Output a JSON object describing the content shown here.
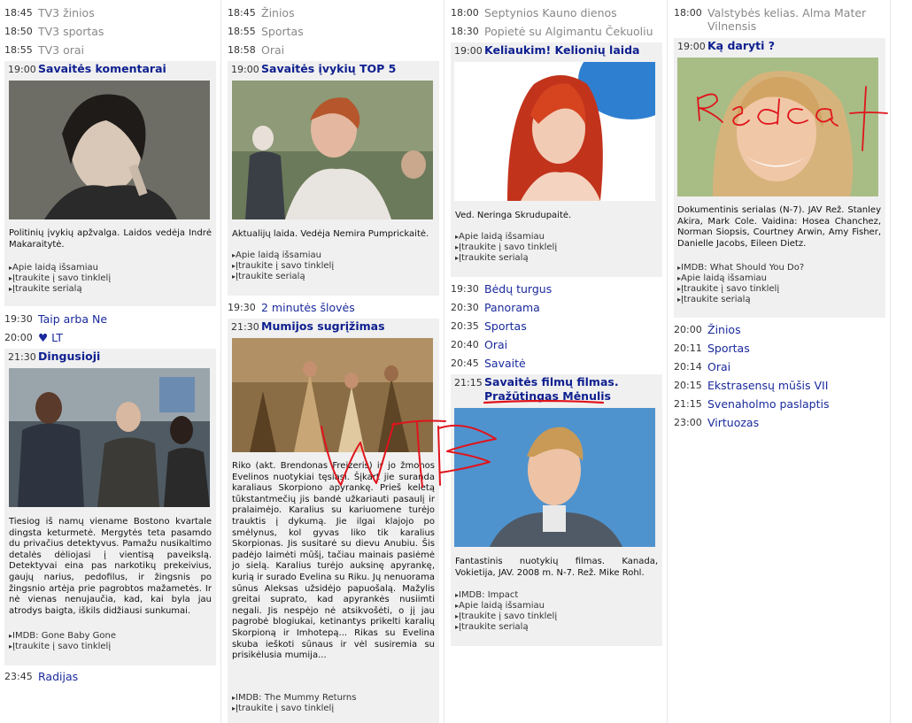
{
  "col1": {
    "pre": [
      {
        "time": "18:45",
        "title": "TV3 žinios"
      },
      {
        "time": "18:50",
        "title": "TV3 sportas"
      },
      {
        "time": "18:55",
        "title": "TV3 orai"
      }
    ],
    "feat1": {
      "time": "19:00",
      "title": "Savaitės komentarai",
      "desc": "Politinių įvykių apžvalga. Laidos vedėja Indrė Makaraitytė.",
      "links": [
        "Apie laidą išsamiau",
        "Įtraukite į savo tinklelį",
        "Įtraukite serialą"
      ]
    },
    "mid": [
      {
        "time": "19:30",
        "title": "Taip arba Ne"
      },
      {
        "time": "20:00",
        "title": "♥ LT"
      }
    ],
    "feat2": {
      "time": "21:30",
      "title": "Dingusioji",
      "desc": "Tiesiog iš namų viename Bostono kvartale dingsta keturmetė. Mergytės teta pasamdo du privačius detektyvus. Pamažu nusikaltimo detalės dėliojasi į vientisą paveikslą. Detektyvai eina pas narkotikų prekeivius, gaujų narius, pedofilus, ir žingsnis po žingsnio artėja prie pagrobtos mažametės. Ir nė vienas nenujaučia, kad, kai byla jau atrodys baigta, iškils didžiausi sunkumai.",
      "links": [
        "IMDB: Gone Baby Gone",
        "Įtraukite į savo tinklelį"
      ]
    },
    "post": [
      {
        "time": "23:45",
        "title": "Radijas"
      }
    ]
  },
  "col2": {
    "pre": [
      {
        "time": "18:45",
        "title": "Žinios"
      },
      {
        "time": "18:55",
        "title": "Sportas"
      },
      {
        "time": "18:58",
        "title": "Orai"
      }
    ],
    "feat1": {
      "time": "19:00",
      "title": "Savaitės įvykių TOP 5",
      "desc": "Aktualijų laida. Vedėja Nemira Pumprickaitė.",
      "links": [
        "Apie laidą išsamiau",
        "Įtraukite į savo tinklelį",
        "Įtraukite serialą"
      ]
    },
    "mid": [
      {
        "time": "19:30",
        "title": "2 minutės šlovės"
      }
    ],
    "feat2": {
      "time": "21:30",
      "title": "Mumijos sugrįžimas",
      "desc": "Riko (akt. Brendonas Freizeris) ir jo žmonos Evelinos nuotykiai tęsiasi. Šįkart jie suranda karaliaus Skorpiono apyrankę. Prieš keletą tūkstantmečių jis bandė užkariauti pasaulį ir pralaimėjo. Karalius su kariuomene turėjo trauktis į dykumą. Jie ilgai klajojo po smėlynus, kol gyvas liko tik karalius Skorpionas. Jis susitarė su dievu Anubiu. Šis padėjo laimėti mūšį, tačiau mainais pasiėmė jo sielą. Karalius turėjo auksinę apyrankę, kurią ir surado Evelina su Riku. Jų nenuorama sūnus Aleksas užsidėjo papuošalą. Mažylis greitai suprato, kad apyrankės nusiimti negali. Jis nespėjo nė atsikvošėti, o jį jau pagrobė blogiukai, ketinantys prikelti karalių Skorpioną ir Imhotepą... Rikas su Evelina skuba ieškoti sūnaus ir vėl susiremia su prisikėlusia mumija...",
      "links": [
        "IMDB: The Mummy Returns",
        "Įtraukite į savo tinklelį"
      ]
    }
  },
  "col3": {
    "pre": [
      {
        "time": "18:00",
        "title": "Septynios Kauno dienos"
      },
      {
        "time": "18:30",
        "title": "Popietė su Algimantu Čekuoliu"
      }
    ],
    "feat1": {
      "time": "19:00",
      "title": "Keliaukim! Kelionių laida",
      "desc": "Ved. Neringa Skrudupaitė.",
      "links": [
        "Apie laidą išsamiau",
        "Įtraukite į savo tinklelį",
        "Įtraukite serialą"
      ]
    },
    "mid": [
      {
        "time": "19:30",
        "title": "Bėdų turgus"
      },
      {
        "time": "20:30",
        "title": "Panorama"
      },
      {
        "time": "20:35",
        "title": "Sportas"
      },
      {
        "time": "20:40",
        "title": "Orai"
      },
      {
        "time": "20:45",
        "title": "Savaitė"
      }
    ],
    "feat2": {
      "time": "21:15",
      "title1": "Savaitės filmų filmas.",
      "title2": "Pražūtingas Mėnulis",
      "desc": "Fantastinis nuotykių filmas. Kanada, Vokietija, JAV. 2008 m. N-7. Rež. Mike Rohl.",
      "links": [
        "IMDB: Impact",
        "Apie laidą išsamiau",
        "Įtraukite į savo tinklelį",
        "Įtraukite serialą"
      ]
    }
  },
  "col4": {
    "pre": [
      {
        "time": "18:00",
        "title": "Valstybės kelias. Alma Mater Vilnensis"
      }
    ],
    "feat1": {
      "time": "19:00",
      "title": "Ką daryti ?",
      "desc": "Dokumentinis serialas (N-7). JAV Rež. Stanley Akira, Mark Cole. Vaidina: Hosea Chanchez, Norman Siopsis, Courtney Arwin, Amy Fisher, Danielle Jacobs, Eileen Dietz.",
      "links": [
        "IMDB: What Should You Do?",
        "Apie laidą išsamiau",
        "Įtraukite į savo tinklelį",
        "Įtraukite serialą"
      ]
    },
    "post": [
      {
        "time": "20:00",
        "title": "Žinios"
      },
      {
        "time": "20:11",
        "title": "Sportas"
      },
      {
        "time": "20:14",
        "title": "Orai"
      },
      {
        "time": "20:15",
        "title": "Ekstrasensų mūšis VII"
      },
      {
        "time": "21:15",
        "title": "Svenaholmo paslaptis"
      },
      {
        "time": "23:00",
        "title": "Virtuozas"
      }
    ]
  },
  "annotations": {
    "wtf": "WTF",
    "redcat": "Redcat"
  },
  "colors": {
    "link": "#1a2a9c",
    "title": "#0e1f8f",
    "grey": "#888888",
    "featured_bg": "#f0f0f0",
    "annotation": "#e0141c"
  }
}
